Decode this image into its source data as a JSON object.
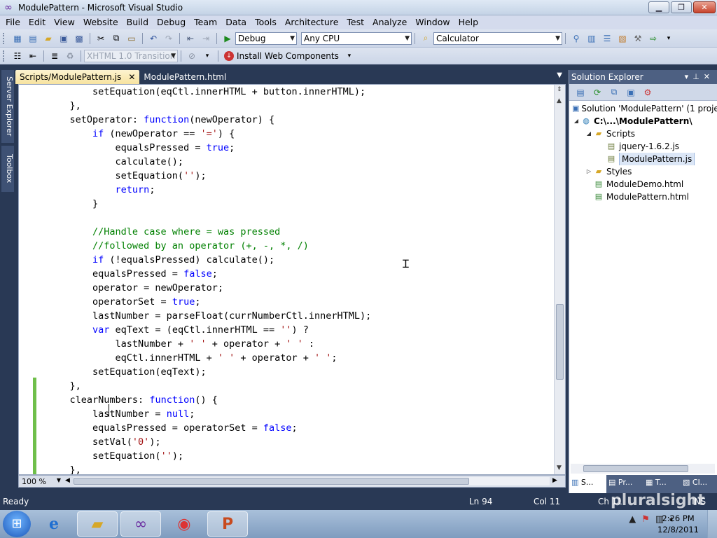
{
  "window": {
    "title": "ModulePattern - Microsoft Visual Studio",
    "controls": [
      "▁",
      "❐",
      "✕"
    ]
  },
  "menu": [
    "File",
    "Edit",
    "View",
    "Website",
    "Build",
    "Debug",
    "Team",
    "Data",
    "Tools",
    "Architecture",
    "Test",
    "Analyze",
    "Window",
    "Help"
  ],
  "toolbar": {
    "config": "Debug",
    "platform": "Any CPU",
    "find": "Calculator",
    "doctype": "XHTML 1.0 Transition",
    "install": "Install Web Components"
  },
  "left_tabs": [
    "Server Explorer",
    "Toolbox"
  ],
  "tabs": {
    "active": "Scripts/ModulePattern.js",
    "inactive": "ModulePattern.html",
    "close": "✕"
  },
  "code_lines": [
    [
      {
        "t": "        setEquation(eqCtl.innerHTML + button.innerHTML);",
        "c": ""
      }
    ],
    [
      {
        "t": "    },",
        "c": ""
      }
    ],
    [
      {
        "t": "    setOperator: ",
        "c": ""
      },
      {
        "t": "function",
        "c": "kw"
      },
      {
        "t": "(newOperator) {",
        "c": ""
      }
    ],
    [
      {
        "t": "        ",
        "c": ""
      },
      {
        "t": "if",
        "c": "kw"
      },
      {
        "t": " (newOperator == ",
        "c": ""
      },
      {
        "t": "'='",
        "c": "st"
      },
      {
        "t": ") {",
        "c": ""
      }
    ],
    [
      {
        "t": "            equalsPressed = ",
        "c": ""
      },
      {
        "t": "true",
        "c": "kw"
      },
      {
        "t": ";",
        "c": ""
      }
    ],
    [
      {
        "t": "            calculate();",
        "c": ""
      }
    ],
    [
      {
        "t": "            setEquation(",
        "c": ""
      },
      {
        "t": "''",
        "c": "st"
      },
      {
        "t": ");",
        "c": ""
      }
    ],
    [
      {
        "t": "            ",
        "c": ""
      },
      {
        "t": "return",
        "c": "kw"
      },
      {
        "t": ";",
        "c": ""
      }
    ],
    [
      {
        "t": "        }",
        "c": ""
      }
    ],
    [
      {
        "t": "",
        "c": ""
      }
    ],
    [
      {
        "t": "        //Handle case where = was pressed",
        "c": "cm"
      }
    ],
    [
      {
        "t": "        //followed by an operator (+, -, *, /)",
        "c": "cm"
      }
    ],
    [
      {
        "t": "        ",
        "c": ""
      },
      {
        "t": "if",
        "c": "kw"
      },
      {
        "t": " (!equalsPressed) calculate();",
        "c": ""
      }
    ],
    [
      {
        "t": "        equalsPressed = ",
        "c": ""
      },
      {
        "t": "false",
        "c": "kw"
      },
      {
        "t": ";",
        "c": ""
      }
    ],
    [
      {
        "t": "        operator = newOperator;",
        "c": ""
      }
    ],
    [
      {
        "t": "        operatorSet = ",
        "c": ""
      },
      {
        "t": "true",
        "c": "kw"
      },
      {
        "t": ";",
        "c": ""
      }
    ],
    [
      {
        "t": "        lastNumber = parseFloat(currNumberCtl.innerHTML);",
        "c": ""
      }
    ],
    [
      {
        "t": "        ",
        "c": ""
      },
      {
        "t": "var",
        "c": "kw"
      },
      {
        "t": " eqText = (eqCtl.innerHTML == ",
        "c": ""
      },
      {
        "t": "''",
        "c": "st"
      },
      {
        "t": ") ?",
        "c": ""
      }
    ],
    [
      {
        "t": "            lastNumber + ",
        "c": ""
      },
      {
        "t": "' '",
        "c": "st"
      },
      {
        "t": " + operator + ",
        "c": ""
      },
      {
        "t": "' '",
        "c": "st"
      },
      {
        "t": " :",
        "c": ""
      }
    ],
    [
      {
        "t": "            eqCtl.innerHTML + ",
        "c": ""
      },
      {
        "t": "' '",
        "c": "st"
      },
      {
        "t": " + operator + ",
        "c": ""
      },
      {
        "t": "' '",
        "c": "st"
      },
      {
        "t": ";",
        "c": ""
      }
    ],
    [
      {
        "t": "        setEquation(eqText);",
        "c": ""
      }
    ],
    [
      {
        "t": "    },",
        "c": ""
      }
    ],
    [
      {
        "t": "    clearNumbers: ",
        "c": ""
      },
      {
        "t": "function",
        "c": "kw"
      },
      {
        "t": "() {",
        "c": ""
      }
    ],
    [
      {
        "t": "        lastNumber = ",
        "c": ""
      },
      {
        "t": "null",
        "c": "kw"
      },
      {
        "t": ";",
        "c": ""
      }
    ],
    [
      {
        "t": "        equalsPressed = operatorSet = ",
        "c": ""
      },
      {
        "t": "false",
        "c": "kw"
      },
      {
        "t": ";",
        "c": ""
      }
    ],
    [
      {
        "t": "        setVal(",
        "c": ""
      },
      {
        "t": "'0'",
        "c": "st"
      },
      {
        "t": ");",
        "c": ""
      }
    ],
    [
      {
        "t": "        setEquation(",
        "c": ""
      },
      {
        "t": "''",
        "c": "st"
      },
      {
        "t": ");",
        "c": ""
      }
    ],
    [
      {
        "t": "    },",
        "c": ""
      }
    ]
  ],
  "editor": {
    "zoom": "100 %"
  },
  "solution_explorer": {
    "title": "Solution Explorer",
    "tree": [
      {
        "label": "Solution 'ModulePattern' (1 proje",
        "level": 0,
        "expander": "",
        "icon": "solution",
        "bold": false,
        "selected": false
      },
      {
        "label": "C:\\...\\ModulePattern\\",
        "level": 0,
        "expander": "◢",
        "icon": "web-project",
        "bold": true,
        "selected": false
      },
      {
        "label": "Scripts",
        "level": 1,
        "expander": "◢",
        "icon": "folder",
        "bold": false,
        "selected": false
      },
      {
        "label": "jquery-1.6.2.js",
        "level": 2,
        "expander": "",
        "icon": "js-file",
        "bold": false,
        "selected": false
      },
      {
        "label": "ModulePattern.js",
        "level": 2,
        "expander": "",
        "icon": "js-file",
        "bold": false,
        "selected": true
      },
      {
        "label": "Styles",
        "level": 1,
        "expander": "▷",
        "icon": "folder",
        "bold": false,
        "selected": false
      },
      {
        "label": "ModuleDemo.html",
        "level": 1,
        "expander": "",
        "icon": "html-file",
        "bold": false,
        "selected": false
      },
      {
        "label": "ModulePattern.html",
        "level": 1,
        "expander": "",
        "icon": "html-file",
        "bold": false,
        "selected": false
      }
    ],
    "bottom_tabs": [
      "S...",
      "Pr...",
      "T...",
      "Cl..."
    ]
  },
  "status": {
    "ready": "Ready",
    "ln": "Ln 94",
    "col": "Col 11",
    "ch": "Ch 11",
    "ins": "INS"
  },
  "watermark": "pluralsight",
  "clock": {
    "time": "2:26 PM",
    "date": "12/8/2011"
  },
  "colors": {
    "keyword": "#0000ff",
    "comment": "#008000",
    "string": "#a31515",
    "chrome": "#293955",
    "active_tab": "#f7e3a0"
  }
}
